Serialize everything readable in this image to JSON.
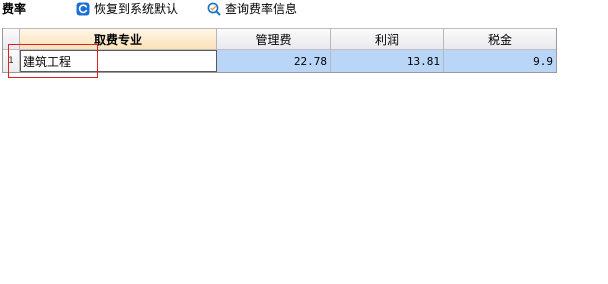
{
  "toolbar": {
    "title": "费率",
    "restore_label": "恢复到系统默认",
    "query_label": "查询费率信息"
  },
  "grid": {
    "headers": {
      "name": "取费专业",
      "mgmt": "管理费",
      "profit": "利润",
      "tax": "税金"
    },
    "rows": [
      {
        "index": "1",
        "name": "建筑工程",
        "mgmt": "22.78",
        "profit": "13.81",
        "tax": "9.9"
      }
    ]
  },
  "colors": {
    "accent_blue": "#1a6fd6",
    "selected_row": "#b9d5f7",
    "active_header": "#fbe2b9",
    "highlight_red": "#e02020"
  }
}
